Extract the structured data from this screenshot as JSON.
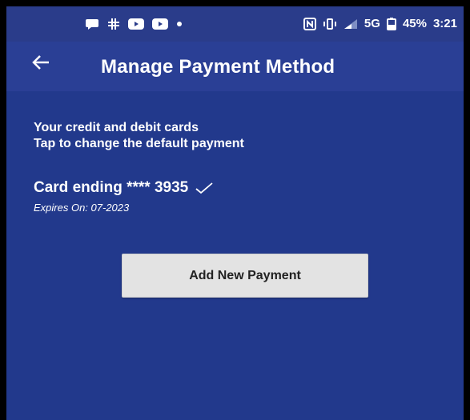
{
  "status_bar": {
    "network": "5G",
    "battery": "45%",
    "time": "3:21",
    "left_icons": [
      "message-icon",
      "slack-icon",
      "youtube-icon",
      "youtube-icon",
      "dot-icon"
    ],
    "right_icons": [
      "nfc-icon",
      "vibrate-icon",
      "signal-icon",
      "battery-icon"
    ]
  },
  "header": {
    "back_icon": "arrow-left-icon",
    "title": "Manage Payment Method"
  },
  "intro": {
    "line1": "Your credit and debit cards",
    "line2": "Tap to change the default payment"
  },
  "card": {
    "label": "Card ending **** 3935",
    "expires": "Expires On: 07-2023",
    "selected_icon": "checkmark-icon"
  },
  "actions": {
    "add_payment_label": "Add New Payment"
  },
  "colors": {
    "background": "#22398c",
    "appbar": "#2a3f95",
    "button": "#e3e3e3"
  }
}
